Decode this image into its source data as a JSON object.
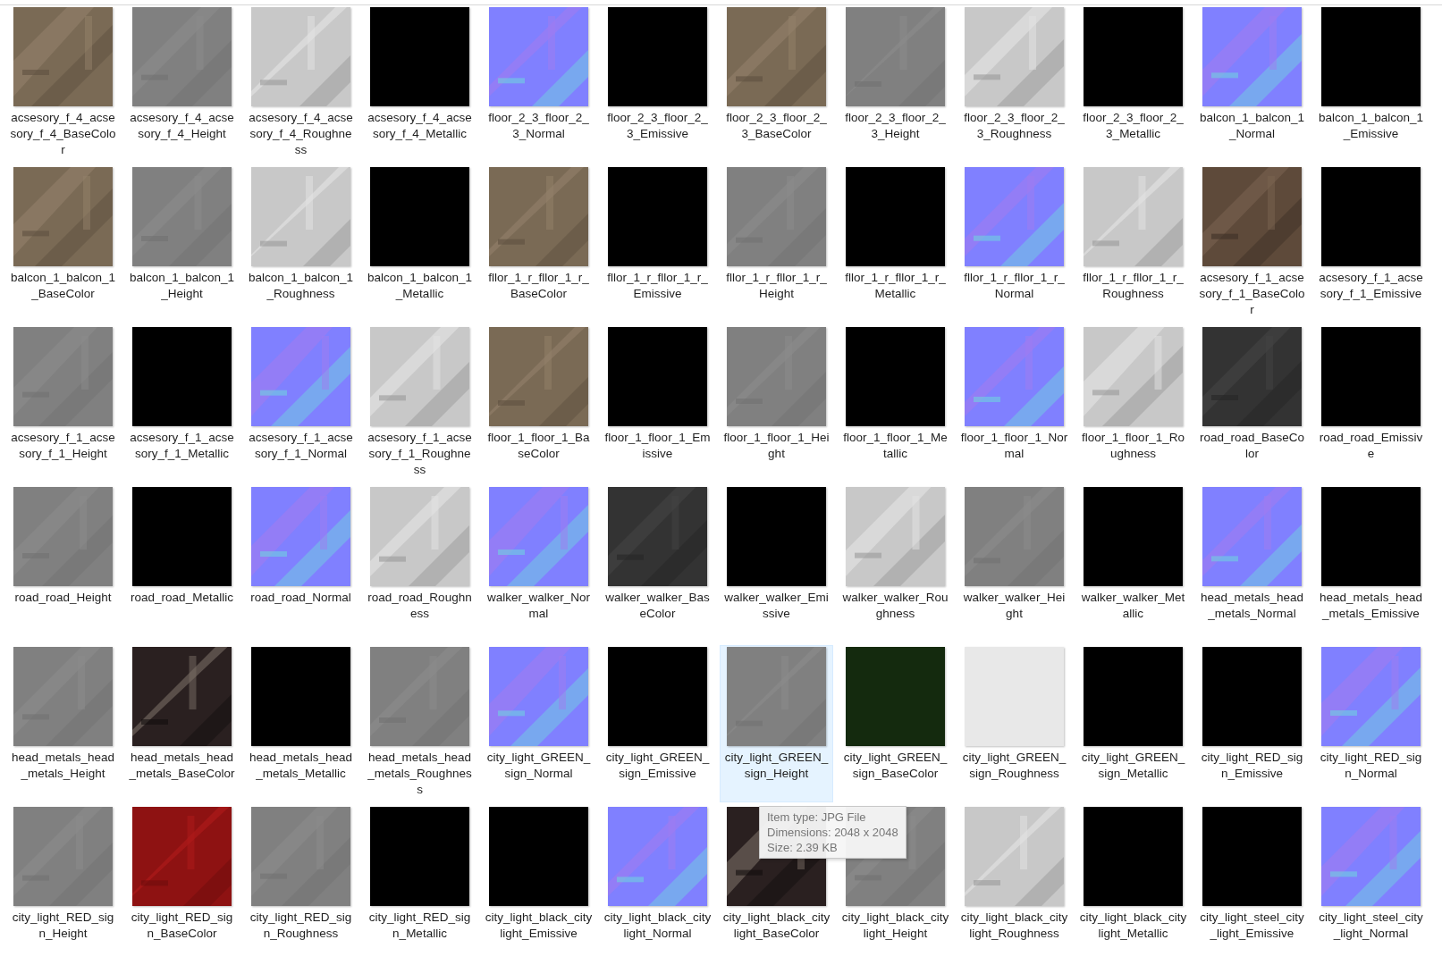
{
  "files": [
    {
      "name": "acsesory_f_4_acsesory_f_4_BaseColor",
      "selected": false
    },
    {
      "name": "acsesory_f_4_acsesory_f_4_Height",
      "selected": false
    },
    {
      "name": "acsesory_f_4_acsesory_f_4_Roughness",
      "selected": false
    },
    {
      "name": "acsesory_f_4_acsesory_f_4_Metallic",
      "selected": false
    },
    {
      "name": "floor_2_3_floor_2_3_Normal",
      "selected": false
    },
    {
      "name": "floor_2_3_floor_2_3_Emissive",
      "selected": false
    },
    {
      "name": "floor_2_3_floor_2_3_BaseColor",
      "selected": false
    },
    {
      "name": "floor_2_3_floor_2_3_Height",
      "selected": false
    },
    {
      "name": "floor_2_3_floor_2_3_Roughness",
      "selected": false
    },
    {
      "name": "floor_2_3_floor_2_3_Metallic",
      "selected": false
    },
    {
      "name": "balcon_1_balcon_1_Normal",
      "selected": false
    },
    {
      "name": "balcon_1_balcon_1_Emissive",
      "selected": false
    },
    {
      "name": "balcon_1_balcon_1_BaseColor",
      "selected": false
    },
    {
      "name": "balcon_1_balcon_1_Height",
      "selected": false
    },
    {
      "name": "balcon_1_balcon_1_Roughness",
      "selected": false
    },
    {
      "name": "balcon_1_balcon_1_Metallic",
      "selected": false
    },
    {
      "name": "fllor_1_r_fllor_1_r_BaseColor",
      "selected": false
    },
    {
      "name": "fllor_1_r_fllor_1_r_Emissive",
      "selected": false
    },
    {
      "name": "fllor_1_r_fllor_1_r_Height",
      "selected": false
    },
    {
      "name": "fllor_1_r_fllor_1_r_Metallic",
      "selected": false
    },
    {
      "name": "fllor_1_r_fllor_1_r_Normal",
      "selected": false
    },
    {
      "name": "fllor_1_r_fllor_1_r_Roughness",
      "selected": false
    },
    {
      "name": "acsesory_f_1_acsesory_f_1_BaseColor",
      "selected": false
    },
    {
      "name": "acsesory_f_1_acsesory_f_1_Emissive",
      "selected": false
    },
    {
      "name": "acsesory_f_1_acsesory_f_1_Height",
      "selected": false
    },
    {
      "name": "acsesory_f_1_acsesory_f_1_Metallic",
      "selected": false
    },
    {
      "name": "acsesory_f_1_acsesory_f_1_Normal",
      "selected": false
    },
    {
      "name": "acsesory_f_1_acsesory_f_1_Roughness",
      "selected": false
    },
    {
      "name": "floor_1_floor_1_BaseColor",
      "selected": false
    },
    {
      "name": "floor_1_floor_1_Emissive",
      "selected": false
    },
    {
      "name": "floor_1_floor_1_Height",
      "selected": false
    },
    {
      "name": "floor_1_floor_1_Metallic",
      "selected": false
    },
    {
      "name": "floor_1_floor_1_Normal",
      "selected": false
    },
    {
      "name": "floor_1_floor_1_Roughness",
      "selected": false
    },
    {
      "name": "road_road_BaseColor",
      "selected": false
    },
    {
      "name": "road_road_Emissive",
      "selected": false
    },
    {
      "name": "road_road_Height",
      "selected": false
    },
    {
      "name": "road_road_Metallic",
      "selected": false
    },
    {
      "name": "road_road_Normal",
      "selected": false
    },
    {
      "name": "road_road_Roughness",
      "selected": false
    },
    {
      "name": "walker_walker_Normal",
      "selected": false
    },
    {
      "name": "walker_walker_BaseColor",
      "selected": false
    },
    {
      "name": "walker_walker_Emissive",
      "selected": false
    },
    {
      "name": "walker_walker_Roughness",
      "selected": false
    },
    {
      "name": "walker_walker_Height",
      "selected": false
    },
    {
      "name": "walker_walker_Metallic",
      "selected": false
    },
    {
      "name": "head_metals_head_metals_Normal",
      "selected": false
    },
    {
      "name": "head_metals_head_metals_Emissive",
      "selected": false
    },
    {
      "name": "head_metals_head_metals_Height",
      "selected": false
    },
    {
      "name": "head_metals_head_metals_BaseColor",
      "selected": false
    },
    {
      "name": "head_metals_head_metals_Metallic",
      "selected": false
    },
    {
      "name": "head_metals_head_metals_Roughness",
      "selected": false
    },
    {
      "name": "city_light_GREEN_sign_Normal",
      "selected": false
    },
    {
      "name": "city_light_GREEN_sign_Emissive",
      "selected": false
    },
    {
      "name": "city_light_GREEN_sign_Height",
      "selected": true
    },
    {
      "name": "city_light_GREEN_sign_BaseColor",
      "selected": false
    },
    {
      "name": "city_light_GREEN_sign_Roughness",
      "selected": false
    },
    {
      "name": "city_light_GREEN_sign_Metallic",
      "selected": false
    },
    {
      "name": "city_light_RED_sign_Emissive",
      "selected": false
    },
    {
      "name": "city_light_RED_sign_Normal",
      "selected": false
    },
    {
      "name": "city_light_RED_sign_Height",
      "selected": false
    },
    {
      "name": "city_light_RED_sign_BaseColor",
      "selected": false
    },
    {
      "name": "city_light_RED_sign_Roughness",
      "selected": false
    },
    {
      "name": "city_light_RED_sign_Metallic",
      "selected": false
    },
    {
      "name": "city_light_black_city light_Emissive",
      "selected": false
    },
    {
      "name": "city_light_black_city light_Normal",
      "selected": false
    },
    {
      "name": "city_light_black_city light_BaseColor",
      "selected": false
    },
    {
      "name": "city_light_black_city light_Height",
      "selected": false
    },
    {
      "name": "city_light_black_city light_Roughness",
      "selected": false
    },
    {
      "name": "city_light_black_city light_Metallic",
      "selected": false
    },
    {
      "name": "city_light_steel_city_light_Emissive",
      "selected": false
    },
    {
      "name": "city_light_steel_city_light_Normal",
      "selected": false
    }
  ],
  "tooltip": {
    "lines": [
      "Item type: JPG File",
      "Dimensions: 2048 x 2048",
      "Size: 2.39 KB"
    ]
  }
}
